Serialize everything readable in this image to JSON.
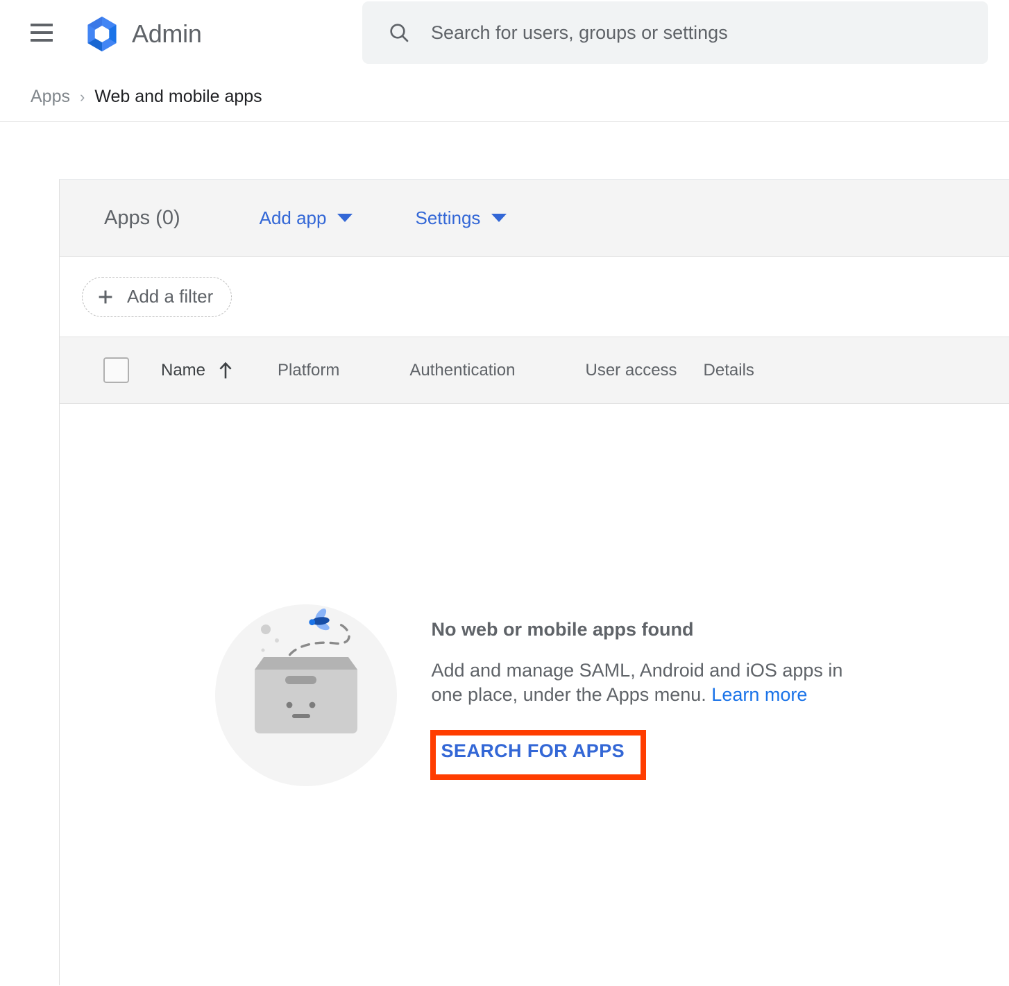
{
  "header": {
    "menu_icon": "hamburger-menu-icon",
    "brand_title": "Admin",
    "brand_logo_icon": "google-admin-hexagon-logo",
    "search": {
      "icon": "search-icon",
      "value": "",
      "placeholder": "Search for users, groups or settings"
    }
  },
  "breadcrumb": {
    "parent": "Apps",
    "separator": "›",
    "current": "Web and mobile apps"
  },
  "toolbar": {
    "apps_count_label": "Apps (0)",
    "add_app_label": "Add app",
    "settings_label": "Settings",
    "caret_icon": "chevron-down-icon",
    "link_color": "#3367d6"
  },
  "filter": {
    "plus_icon": "plus-icon",
    "add_filter_label": "Add a filter"
  },
  "table": {
    "select_all_checked": false,
    "sort_column": "Name",
    "sort_direction": "ascending",
    "sort_icon": "arrow-up-icon",
    "columns": [
      {
        "label": "Name"
      },
      {
        "label": "Platform"
      },
      {
        "label": "Authentication"
      },
      {
        "label": "User access"
      },
      {
        "label": "Details"
      }
    ],
    "rows": []
  },
  "empty_state": {
    "illustration_icon": "empty-box-with-bee-illustration",
    "title": "No web or mobile apps found",
    "body_text": "Add and manage SAML, Android and iOS apps in one place, under the Apps menu. ",
    "learn_more_label": "Learn more",
    "cta_label": "SEARCH FOR APPS"
  },
  "annotation": {
    "highlight_target": "SEARCH FOR APPS",
    "highlight_color": "#ff3d00"
  },
  "colors": {
    "accent_blue": "#1a73e8",
    "link_blue": "#3367d6",
    "text_gray": "#5f6368",
    "text_dark": "#202124",
    "panel_gray": "#f4f4f4",
    "search_field_gray": "#f1f3f4",
    "border_gray": "#e0e0e0",
    "highlight_orange": "#ff3d00"
  }
}
